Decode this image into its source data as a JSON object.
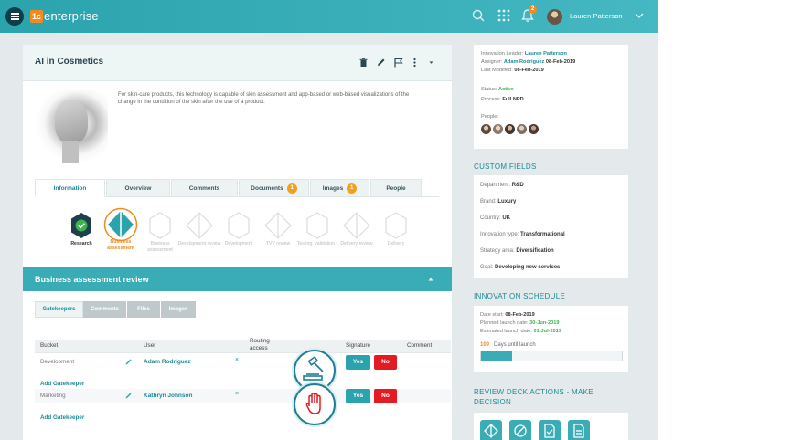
{
  "app": {
    "logo_badge": "1c",
    "logo_text": "enterprise",
    "notifications": "2",
    "user_name": "Lauren Patterson"
  },
  "idea": {
    "title": "AI in Cosmetics",
    "description": "For skin-care products, this technology is capable of skin assessment and app-based or web-based visualizations of the change in the condition of the skin after the use of a product."
  },
  "tabs": [
    {
      "label": "Information",
      "count": ""
    },
    {
      "label": "Overview",
      "count": ""
    },
    {
      "label": "Comments",
      "count": ""
    },
    {
      "label": "Documents",
      "count": "1"
    },
    {
      "label": "Images",
      "count": "1"
    },
    {
      "label": "People",
      "count": ""
    }
  ],
  "stages": [
    {
      "label": "Research",
      "state": "done"
    },
    {
      "label": "Business assessment",
      "state": "current"
    },
    {
      "label": "Business assessment",
      "state": "future"
    },
    {
      "label": "Development review",
      "state": "future"
    },
    {
      "label": "Development",
      "state": "future"
    },
    {
      "label": "TVV review",
      "state": "future"
    },
    {
      "label": "Testing, validation (",
      "state": "future"
    },
    {
      "label": "Delivery review",
      "state": "future"
    },
    {
      "label": "Delivery",
      "state": "future"
    }
  ],
  "review": {
    "title": "Business assessment review",
    "subtabs": [
      "Gatekeepers",
      "Comments",
      "Files",
      "Images"
    ],
    "columns": [
      "Bucket",
      "User",
      "Routing access",
      "Signature",
      "Comment"
    ],
    "rows": [
      {
        "bucket": "Development",
        "user": "Adam Rodriguez",
        "remove": "×",
        "yes": "Yes",
        "no": "No",
        "add": "Add Gatekeeper",
        "icon": "gavel-icon"
      },
      {
        "bucket": "Marketing",
        "user": "Kathryn Johnson",
        "remove": "×",
        "yes": "Yes",
        "no": "No",
        "add": "Add Gatekeeper",
        "icon": "hand-stop-icon"
      }
    ]
  },
  "info": {
    "leader_label": "Innovation Leader:",
    "leader": "Lauren Patterson",
    "assigner_label": "Assigner:",
    "assigner": "Adam Rodriguez",
    "assigner_date": "08-Feb-2019",
    "modified_label": "Last Modified:",
    "modified": "08-Feb-2019",
    "status_label": "Status:",
    "status": "Active",
    "process_label": "Process:",
    "process": "Full NPD",
    "people_label": "People:"
  },
  "custom_fields": {
    "title": "CUSTOM FIELDS",
    "items": [
      {
        "label": "Department:",
        "value": "R&D"
      },
      {
        "label": "Brand:",
        "value": "Luxury"
      },
      {
        "label": "Country:",
        "value": "UK"
      },
      {
        "label": "Innovation type:",
        "value": "Transformational"
      },
      {
        "label": "Strategy area:",
        "value": "Diversification"
      },
      {
        "label": "Goal:",
        "value": "Developing new services"
      }
    ]
  },
  "schedule": {
    "title": "INNOVATION SCHEDULE",
    "start_label": "Date start:",
    "start": "08-Feb-2019",
    "planned_label": "Planned launch date:",
    "planned": "30-Jun-2019",
    "estimated_label": "Estimated launch date:",
    "estimated": "01-Jul-2019",
    "days": "109",
    "days_label": "Days until launch",
    "progress": 0.22
  },
  "deck": {
    "title": "REVIEW DECK ACTIONS - MAKE DECISION"
  },
  "colors": {
    "accent": "#3aacb5",
    "orange": "#f28a1e",
    "red": "#e31b23",
    "green": "#3bb54a"
  }
}
